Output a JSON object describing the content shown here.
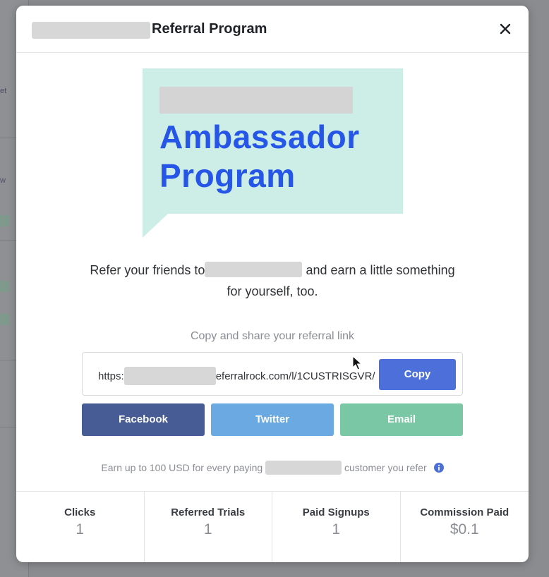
{
  "background": {
    "sidebar_fragments": [
      "et",
      "w",
      "e",
      "e",
      "p"
    ]
  },
  "modal": {
    "title": "Referral Program",
    "close_icon": "close-icon"
  },
  "banner": {
    "title_line1": "Ambassador",
    "title_line2": "Program",
    "colors": {
      "bg": "#cdeee6",
      "text": "#2556e8"
    }
  },
  "intro": {
    "before": "Refer your friends to",
    "after": "and earn a little something",
    "line2": "for yourself, too."
  },
  "share": {
    "label": "Copy and share your referral link",
    "link_prefix": "https:",
    "link_suffix": "eferralrock.com/l/1CUSTRISGVR/",
    "copy_label": "Copy"
  },
  "social": {
    "facebook": "Facebook",
    "twitter": "Twitter",
    "email": "Email",
    "colors": {
      "facebook": "#475b95",
      "twitter": "#6aa9e2",
      "email": "#79c7a4",
      "copy": "#4d6fd9"
    }
  },
  "earn": {
    "before": "Earn up to 100 USD for every paying",
    "after": "customer you refer",
    "icon": "info-icon"
  },
  "stats": [
    {
      "label": "Clicks",
      "value": "1"
    },
    {
      "label": "Referred Trials",
      "value": "1"
    },
    {
      "label": "Paid Signups",
      "value": "1"
    },
    {
      "label": "Commission Paid",
      "value": "$0.1"
    }
  ]
}
